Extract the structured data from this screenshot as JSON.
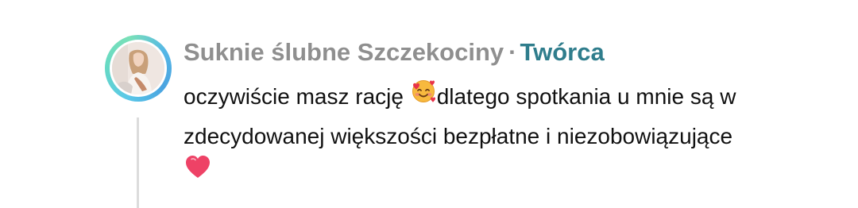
{
  "comment": {
    "author": "Suknie ślubne Szczekociny",
    "separator": "·",
    "author_badge": "Twórca",
    "text_part1": "oczywiście masz rację ",
    "text_part2": "dlatego spotkania u mnie są w zdecydowanej większości bezpłatne i niezobowiązujące",
    "emoji_1": "smiling-face-with-hearts",
    "emoji_2": "red-heart"
  },
  "colors": {
    "author": "#8f8f8f",
    "badge": "#2f7d8c",
    "text": "#111111",
    "thread_line": "#dcdcdc",
    "ring_start": "#5ac8e8",
    "ring_end": "#7ae0b8"
  }
}
